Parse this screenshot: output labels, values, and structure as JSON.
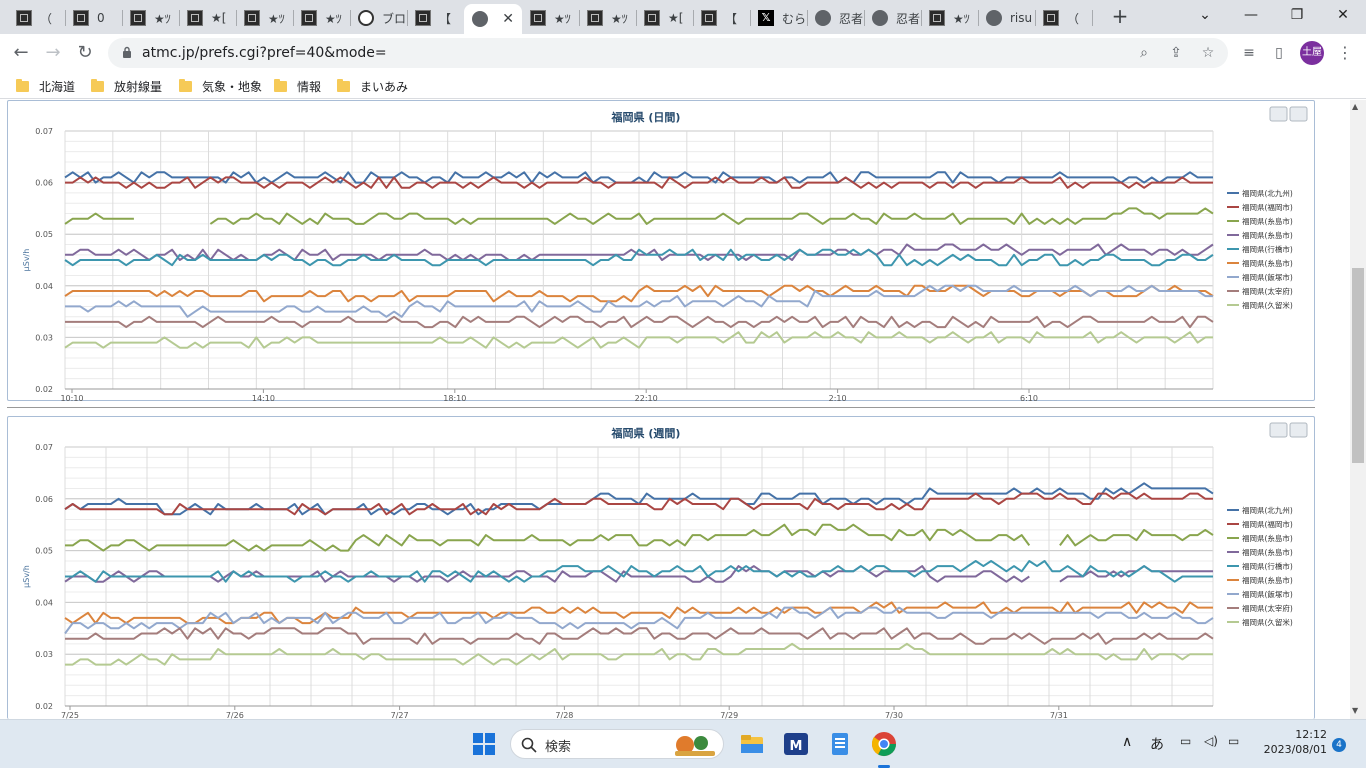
{
  "browser": {
    "tabs": [
      {
        "title": "（",
        "icon": "dark"
      },
      {
        "title": "0 ",
        "icon": "dark"
      },
      {
        "title": "★ﾂ",
        "icon": "dark"
      },
      {
        "title": "★[",
        "icon": "dark"
      },
      {
        "title": "★ﾂ",
        "icon": "dark"
      },
      {
        "title": "★ﾂ",
        "icon": "dark"
      },
      {
        "title": "ブロ",
        "icon": "white"
      },
      {
        "title": "【",
        "icon": "dark"
      },
      {
        "title": "",
        "icon": "globe",
        "active": true
      },
      {
        "title": "★ﾂ",
        "icon": "dark"
      },
      {
        "title": "★ﾂ",
        "icon": "dark"
      },
      {
        "title": "★[",
        "icon": "dark"
      },
      {
        "title": "【",
        "icon": "dark"
      },
      {
        "title": "むら",
        "icon": "x"
      },
      {
        "title": "忍者",
        "icon": "globe"
      },
      {
        "title": "忍者",
        "icon": "globe"
      },
      {
        "title": "★ﾂ",
        "icon": "dark"
      },
      {
        "title": "risu",
        "icon": "globe"
      },
      {
        "title": "（",
        "icon": "dark"
      }
    ],
    "url": "atmc.jp/prefs.cgi?pref=40&mode=",
    "profile_initial": "土屋",
    "bookmarks": [
      "北海道",
      "放射線量",
      "気象・地象",
      "情報",
      "まいあみ"
    ]
  },
  "charts": {
    "daily": {
      "title": "福岡県 (日間)",
      "ylabel": "μSv/h",
      "yticks": [
        "0.07",
        "0.06",
        "0.05",
        "0.04",
        "0.03",
        "0.02"
      ],
      "xticks": [
        "10:10",
        "14:10",
        "18:10",
        "22:10",
        "2:10",
        "6:10"
      ]
    },
    "weekly": {
      "title": "福岡県 (週間)",
      "ylabel": "μSv/h",
      "yticks": [
        "0.07",
        "0.06",
        "0.05",
        "0.04",
        "0.03",
        "0.02"
      ],
      "xticks": [
        "7/25",
        "7/26",
        "7/27",
        "7/28",
        "7/29",
        "7/30",
        "7/31"
      ]
    }
  },
  "chart_data": [
    {
      "type": "line",
      "title": "福岡県 (日間)",
      "ylabel": "μSv/h",
      "ylim": [
        0.02,
        0.07
      ],
      "x": [
        "10:10",
        "14:10",
        "18:10",
        "22:10",
        "2:10",
        "6:10"
      ],
      "grid": true,
      "legend": "right",
      "series": [
        {
          "name": "福岡県(北九州)",
          "color": "#4572a7",
          "values": [
            0.061,
            0.061,
            0.061,
            0.061,
            0.061,
            0.061
          ]
        },
        {
          "name": "福岡県(福岡市)",
          "color": "#aa4643",
          "values": [
            0.06,
            0.06,
            0.06,
            0.06,
            0.06,
            0.06
          ]
        },
        {
          "name": "福岡県(糸島市)",
          "color": "#89a54e",
          "values": [
            0.053,
            0.053,
            0.053,
            0.053,
            0.053,
            0.054
          ]
        },
        {
          "name": "福岡県(糸島市)",
          "color": "#80699b",
          "values": [
            0.046,
            0.046,
            0.046,
            0.046,
            0.047,
            0.047
          ]
        },
        {
          "name": "福岡県(行橋市)",
          "color": "#3d96ae",
          "values": [
            0.045,
            0.045,
            0.045,
            0.046,
            0.045,
            0.045
          ]
        },
        {
          "name": "福岡県(糸島市)",
          "color": "#db843d",
          "values": [
            0.039,
            0.038,
            0.038,
            0.039,
            0.039,
            0.039
          ]
        },
        {
          "name": "福岡県(飯塚市)",
          "color": "#92a8cd",
          "values": [
            0.036,
            0.035,
            0.036,
            0.037,
            0.039,
            0.039
          ]
        },
        {
          "name": "福岡県(太宰府)",
          "color": "#a47d7c",
          "values": [
            0.033,
            0.033,
            0.033,
            0.033,
            0.033,
            0.033
          ]
        },
        {
          "name": "福岡県(久留米)",
          "color": "#b5ca92",
          "values": [
            0.029,
            0.029,
            0.029,
            0.03,
            0.03,
            0.03
          ]
        }
      ]
    },
    {
      "type": "line",
      "title": "福岡県 (週間)",
      "ylabel": "μSv/h",
      "ylim": [
        0.02,
        0.07
      ],
      "x": [
        "7/25",
        "7/26",
        "7/27",
        "7/28",
        "7/29",
        "7/30",
        "7/31"
      ],
      "grid": true,
      "legend": "right",
      "series": [
        {
          "name": "福岡県(北九州)",
          "color": "#4572a7",
          "values": [
            0.059,
            0.058,
            0.058,
            0.06,
            0.06,
            0.061,
            0.062
          ]
        },
        {
          "name": "福岡県(福岡市)",
          "color": "#aa4643",
          "values": [
            0.058,
            0.058,
            0.058,
            0.059,
            0.059,
            0.06,
            0.06
          ]
        },
        {
          "name": "福岡県(糸島市)",
          "color": "#89a54e",
          "values": [
            0.051,
            0.051,
            0.052,
            0.052,
            0.054,
            0.052,
            0.053
          ]
        },
        {
          "name": "福岡県(糸島市)",
          "color": "#80699b",
          "values": [
            0.045,
            0.045,
            0.045,
            0.045,
            0.046,
            0.045,
            0.046
          ]
        },
        {
          "name": "福岡県(行橋市)",
          "color": "#3d96ae",
          "values": [
            0.045,
            0.045,
            0.045,
            0.046,
            0.046,
            0.047,
            0.045
          ]
        },
        {
          "name": "福岡県(糸島市)",
          "color": "#db843d",
          "values": [
            0.037,
            0.037,
            0.038,
            0.038,
            0.039,
            0.039,
            0.039
          ]
        },
        {
          "name": "福岡県(飯塚市)",
          "color": "#92a8cd",
          "values": [
            0.035,
            0.037,
            0.037,
            0.036,
            0.038,
            0.038,
            0.037
          ]
        },
        {
          "name": "福岡県(太宰府)",
          "color": "#a47d7c",
          "values": [
            0.033,
            0.034,
            0.033,
            0.034,
            0.034,
            0.033,
            0.033
          ]
        },
        {
          "name": "福岡県(久留米)",
          "color": "#b5ca92",
          "values": [
            0.028,
            0.03,
            0.029,
            0.03,
            0.031,
            0.03,
            0.03
          ]
        }
      ]
    }
  ],
  "taskbar": {
    "search_placeholder": "検索",
    "ime": "あ",
    "time": "12:12",
    "date": "2023/08/01",
    "notifications": "4"
  }
}
